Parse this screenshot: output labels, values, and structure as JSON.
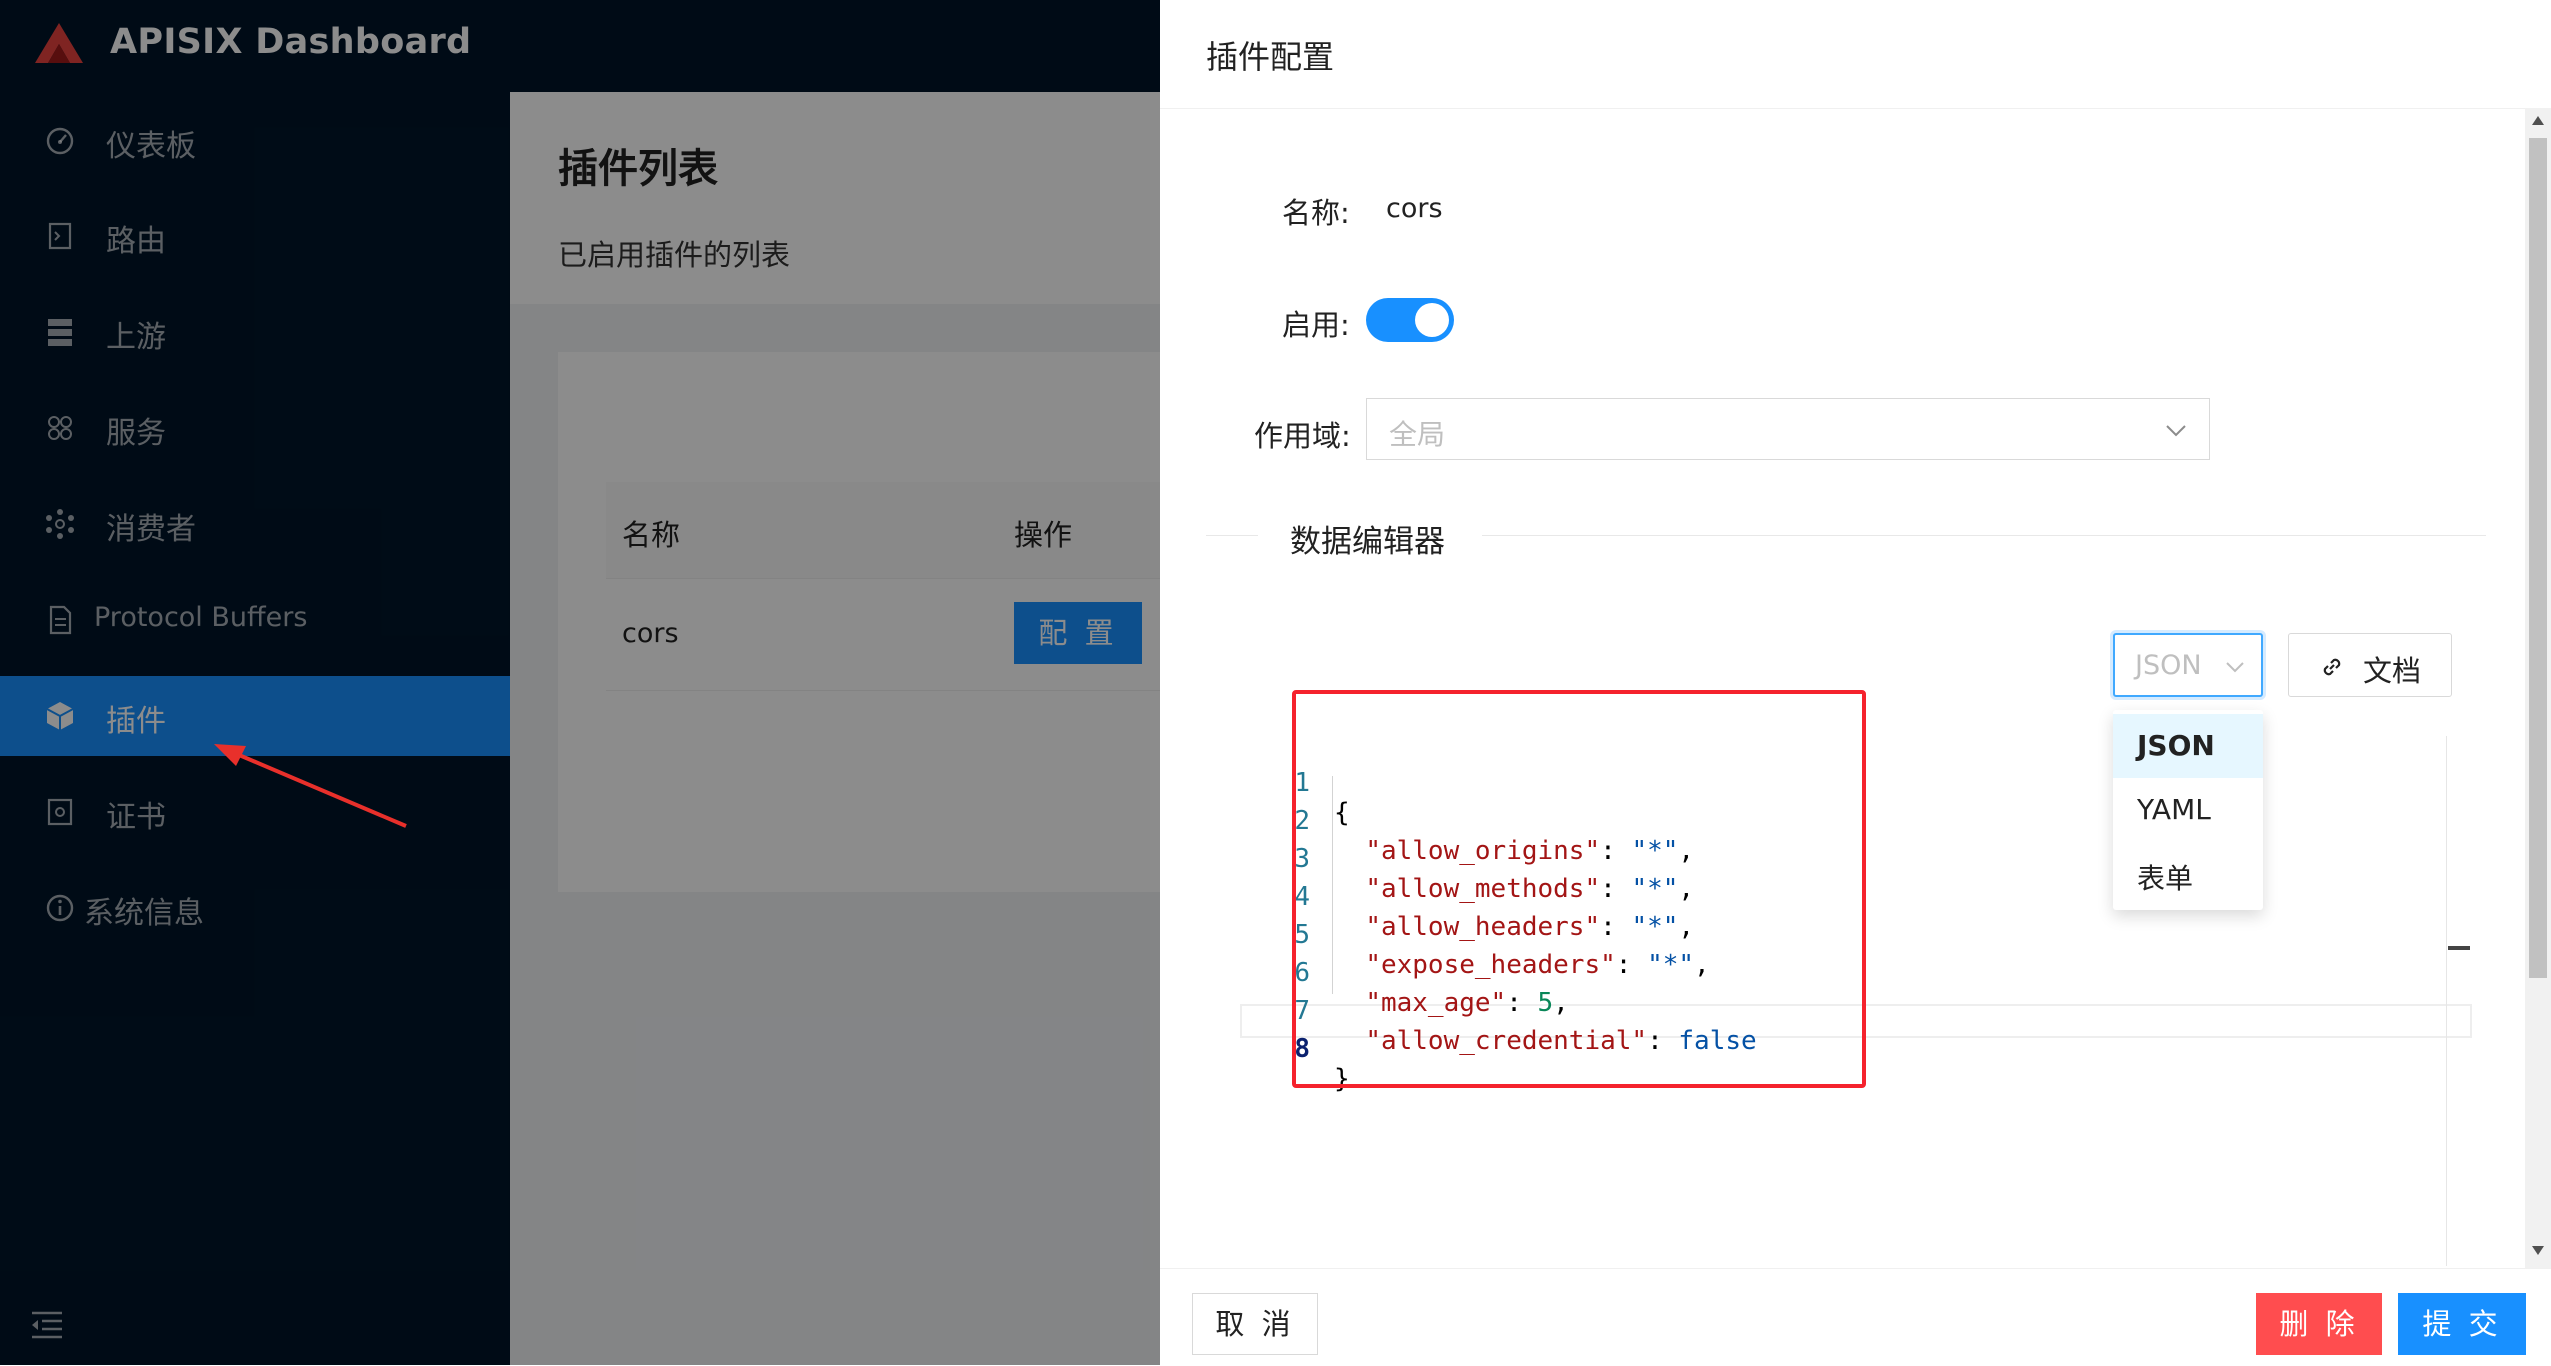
{
  "app": {
    "title": "APISIX Dashboard"
  },
  "sidebar": {
    "items": [
      {
        "label": "仪表板",
        "icon": "dashboard-icon"
      },
      {
        "label": "路由",
        "icon": "route-icon"
      },
      {
        "label": "上游",
        "icon": "upstream-icon"
      },
      {
        "label": "服务",
        "icon": "service-icon"
      },
      {
        "label": "消费者",
        "icon": "consumer-icon"
      },
      {
        "label": "Protocol Buffers",
        "icon": "file-icon"
      },
      {
        "label": "插件",
        "icon": "plugin-icon",
        "active": true
      },
      {
        "label": "证书",
        "icon": "certificate-icon"
      },
      {
        "label": "系统信息",
        "icon": "info-icon"
      }
    ]
  },
  "page": {
    "title": "插件列表",
    "subtitle": "已启用插件的列表",
    "table": {
      "headers": [
        "名称",
        "操作"
      ],
      "rows": [
        {
          "name": "cors",
          "action": "配 置"
        }
      ]
    }
  },
  "drawer": {
    "title": "插件配置",
    "name_label": "名称:",
    "name_value": "cors",
    "enable_label": "启用:",
    "enabled": true,
    "scope_label": "作用域:",
    "scope_placeholder": "全局",
    "editor_section": "数据编辑器",
    "format_value": "JSON",
    "format_options": [
      "JSON",
      "YAML",
      "表单"
    ],
    "doc_button": "文档",
    "code_lines": [
      {
        "no": "1",
        "text": "{"
      },
      {
        "no": "2",
        "key": "\"allow_origins\"",
        "value": "\"*\"",
        "tail": ","
      },
      {
        "no": "3",
        "key": "\"allow_methods\"",
        "value": "\"*\"",
        "tail": ","
      },
      {
        "no": "4",
        "key": "\"allow_headers\"",
        "value": "\"*\"",
        "tail": ","
      },
      {
        "no": "5",
        "key": "\"expose_headers\"",
        "value": "\"*\"",
        "tail": ","
      },
      {
        "no": "6",
        "key": "\"max_age\"",
        "value": "5",
        "tail": ","
      },
      {
        "no": "7",
        "key": "\"allow_credential\"",
        "value": "false",
        "tail": ""
      },
      {
        "no": "8",
        "text": "}"
      }
    ],
    "footer": {
      "cancel": "取 消",
      "delete": "删 除",
      "submit": "提 交"
    }
  },
  "colors": {
    "sidebar_bg": "#001529",
    "primary": "#1890ff",
    "danger": "#ff4d4f",
    "highlight_box": "#f5222d"
  }
}
